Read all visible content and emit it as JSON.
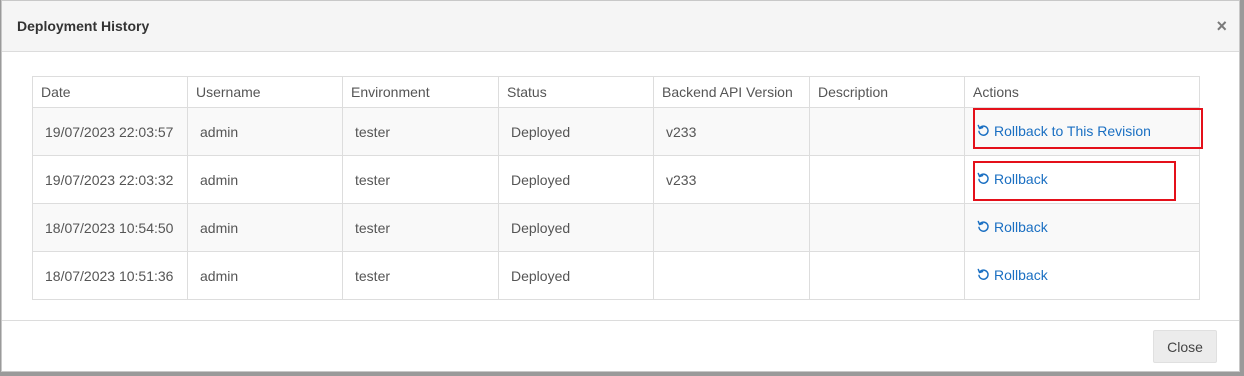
{
  "dialog": {
    "title": "Deployment History",
    "close_symbol": "×"
  },
  "table": {
    "headers": [
      "Date",
      "Username",
      "Environment",
      "Status",
      "Backend API Version",
      "Description",
      "Actions"
    ],
    "rows": [
      {
        "date": "19/07/2023 22:03:57",
        "username": "admin",
        "environment": "tester",
        "status": "Deployed",
        "api_version": "v233",
        "description": "",
        "action": "Rollback to This Revision"
      },
      {
        "date": "19/07/2023 22:03:32",
        "username": "admin",
        "environment": "tester",
        "status": "Deployed",
        "api_version": "v233",
        "description": "",
        "action": "Rollback"
      },
      {
        "date": "18/07/2023 10:54:50",
        "username": "admin",
        "environment": "tester",
        "status": "Deployed",
        "api_version": "",
        "description": "",
        "action": "Rollback"
      },
      {
        "date": "18/07/2023 10:51:36",
        "username": "admin",
        "environment": "tester",
        "status": "Deployed",
        "api_version": "",
        "description": "",
        "action": "Rollback"
      }
    ]
  },
  "footer": {
    "close_label": "Close"
  },
  "colors": {
    "link": "#1a6fc2",
    "highlight": "#e4101a"
  },
  "icons": {
    "rollback": "rotate-ccw-icon"
  }
}
